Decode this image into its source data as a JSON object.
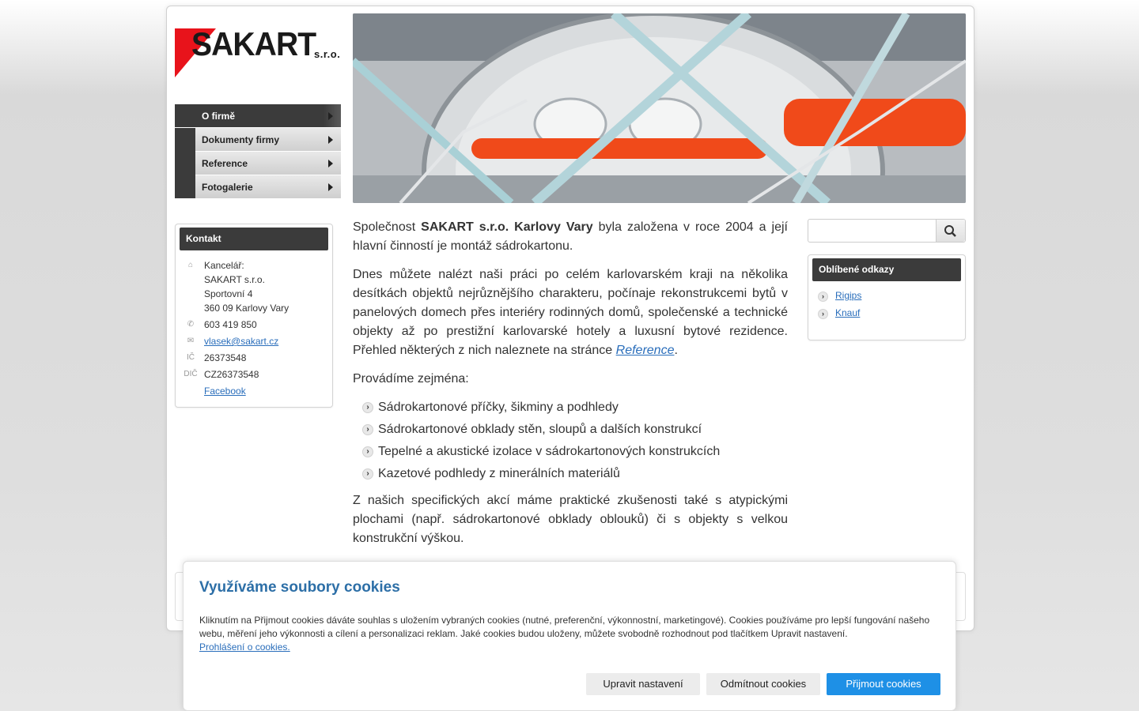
{
  "logo": {
    "name": "SAKART",
    "suffix": "s.r.o."
  },
  "menu": [
    {
      "label": "O firmě",
      "active": true
    },
    {
      "label": "Dokumenty firmy"
    },
    {
      "label": "Reference"
    },
    {
      "label": "Fotogalerie"
    }
  ],
  "contact": {
    "title": "Kontakt",
    "office_label": "Kancelář:",
    "company": "SAKART s.r.o.",
    "street": "Sportovní 4",
    "city": "360 09 Karlovy Vary",
    "phone": "603 419 850",
    "email": "vlasek@sakart.cz",
    "ic_label": "IČ",
    "ic": "26373548",
    "dic_label": "DIČ",
    "dic": "CZ26373548",
    "facebook": "Facebook"
  },
  "main": {
    "p1_a": "Společnost ",
    "p1_b": "SAKART s.r.o. Karlovy Vary",
    "p1_c": " byla založena v roce 2004 a její hlavní činností je montáž sádrokartonu.",
    "p2_a": "Dnes můžete nalézt naši práci po celém karlovarském kraji na několika desítkách objektů nejrůznějšího charakteru, počínaje rekonstrukcemi bytů v panelových domech přes interiéry rodinných domů, společenské a technické objekty až po prestižní karlovarské hotely a luxusní bytové rezidence. Přehled některých z nich naleznete na stránce ",
    "p2_link": "Reference",
    "p2_c": ".",
    "p3": "Provádíme zejména:",
    "list": [
      "Sádrokartonové příčky, šikminy a podhledy",
      "Sádrokartonové obklady stěn, sloupů a dalších konstrukcí",
      "Tepelné a akustické izolace  v sádrokartonových konstrukcích",
      "Kazetové podhledy z minerálních materiálů"
    ],
    "p4": "Z našich specifických akcí máme praktické zkušenosti také s atypickými plochami (např. sádrokartonové obklady oblouků) či s objekty s velkou konstrukční výškou."
  },
  "search": {
    "placeholder": ""
  },
  "links": {
    "title": "Oblíbené odkazy",
    "items": [
      "Rigips",
      "Knauf"
    ]
  },
  "cookie": {
    "title": "Využíváme soubory cookies",
    "text": "Kliknutím na Přijmout cookies dáváte souhlas s uložením vybraných cookies (nutné, preferenční, výkonnostní, marketingové). Cookies používáme pro lepší fungování našeho webu, měření jeho výkonnosti a cílení a personalizaci reklam. Jaké cookies budou uloženy, můžete svobodně rozhodnout pod tlačítkem Upravit nastavení.",
    "policy_link": "Prohlášení o cookies.",
    "btn_settings": "Upravit nastavení",
    "btn_reject": "Odmítnout cookies",
    "btn_accept": "Přijmout cookies"
  },
  "colors": {
    "accent_red": "#e8131b",
    "link_blue": "#2a6ebb",
    "cookie_title": "#2d6fa7",
    "accept_button": "#1e90e6",
    "menu_dark": "#3b3b3b"
  }
}
